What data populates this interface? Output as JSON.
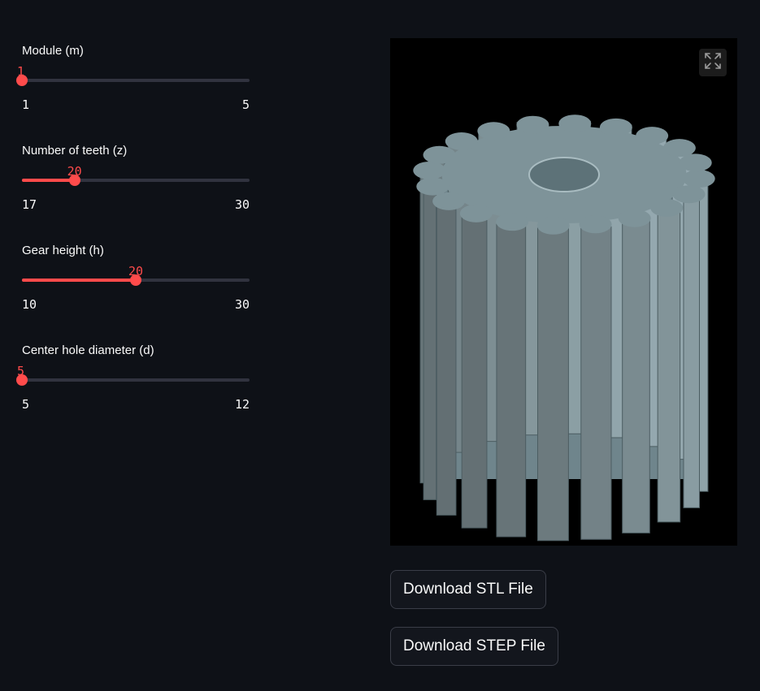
{
  "sliders": [
    {
      "label": "Module (m)",
      "value": 1,
      "min": 1,
      "max": 5
    },
    {
      "label": "Number of teeth (z)",
      "value": 20,
      "min": 17,
      "max": 30
    },
    {
      "label": "Gear height (h)",
      "value": 20,
      "min": 10,
      "max": 30
    },
    {
      "label": "Center hole diameter (d)",
      "value": 5,
      "min": 5,
      "max": 12
    }
  ],
  "buttons": {
    "download_stl": "Download STL File",
    "download_step": "Download STEP File"
  },
  "icons": {
    "fullscreen": "fullscreen-icon"
  },
  "colors": {
    "accent": "#ff4b4b",
    "background": "#0e1117",
    "gear": "#8fa6ad",
    "viewer_bg": "#000000"
  }
}
